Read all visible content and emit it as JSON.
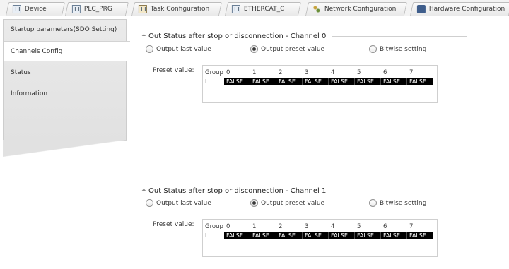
{
  "tabs": [
    {
      "label": "Device",
      "icon": "device-icon"
    },
    {
      "label": "PLC_PRG",
      "icon": "program-icon"
    },
    {
      "label": "Task Configuration",
      "icon": "task-icon"
    },
    {
      "label": "ETHERCAT_C",
      "icon": "ethercat-icon"
    },
    {
      "label": "Network Configuration",
      "icon": "network-icon"
    },
    {
      "label": "Hardware Configuration",
      "icon": "hardware-icon"
    }
  ],
  "sidebar": {
    "items": [
      {
        "label": "Startup parameters(SDO Setting)"
      },
      {
        "label": "Channels Config"
      },
      {
        "label": "Status"
      },
      {
        "label": "Information"
      }
    ]
  },
  "channels": [
    {
      "title": "Out Status after stop or disconnection - Channel 0",
      "options": {
        "last_value": "Output last value",
        "preset_value": "Output preset value",
        "bitwise": "Bitwise setting"
      },
      "selected": "preset_value",
      "preset_label": "Preset value:",
      "table": {
        "headers": [
          "Group",
          "0",
          "1",
          "2",
          "3",
          "4",
          "5",
          "6",
          "7"
        ],
        "row_index": "I",
        "values": [
          "FALSE",
          "FALSE",
          "FALSE",
          "FALSE",
          "FALSE",
          "FALSE",
          "FALSE",
          "FALSE"
        ]
      }
    },
    {
      "title": "Out Status after stop or disconnection - Channel 1",
      "options": {
        "last_value": "Output last value",
        "preset_value": "Output preset value",
        "bitwise": "Bitwise setting"
      },
      "selected": "preset_value",
      "preset_label": "Preset value:",
      "table": {
        "headers": [
          "Group",
          "0",
          "1",
          "2",
          "3",
          "4",
          "5",
          "6",
          "7"
        ],
        "row_index": "I",
        "values": [
          "FALSE",
          "FALSE",
          "FALSE",
          "FALSE",
          "FALSE",
          "FALSE",
          "FALSE",
          "FALSE"
        ]
      }
    }
  ]
}
